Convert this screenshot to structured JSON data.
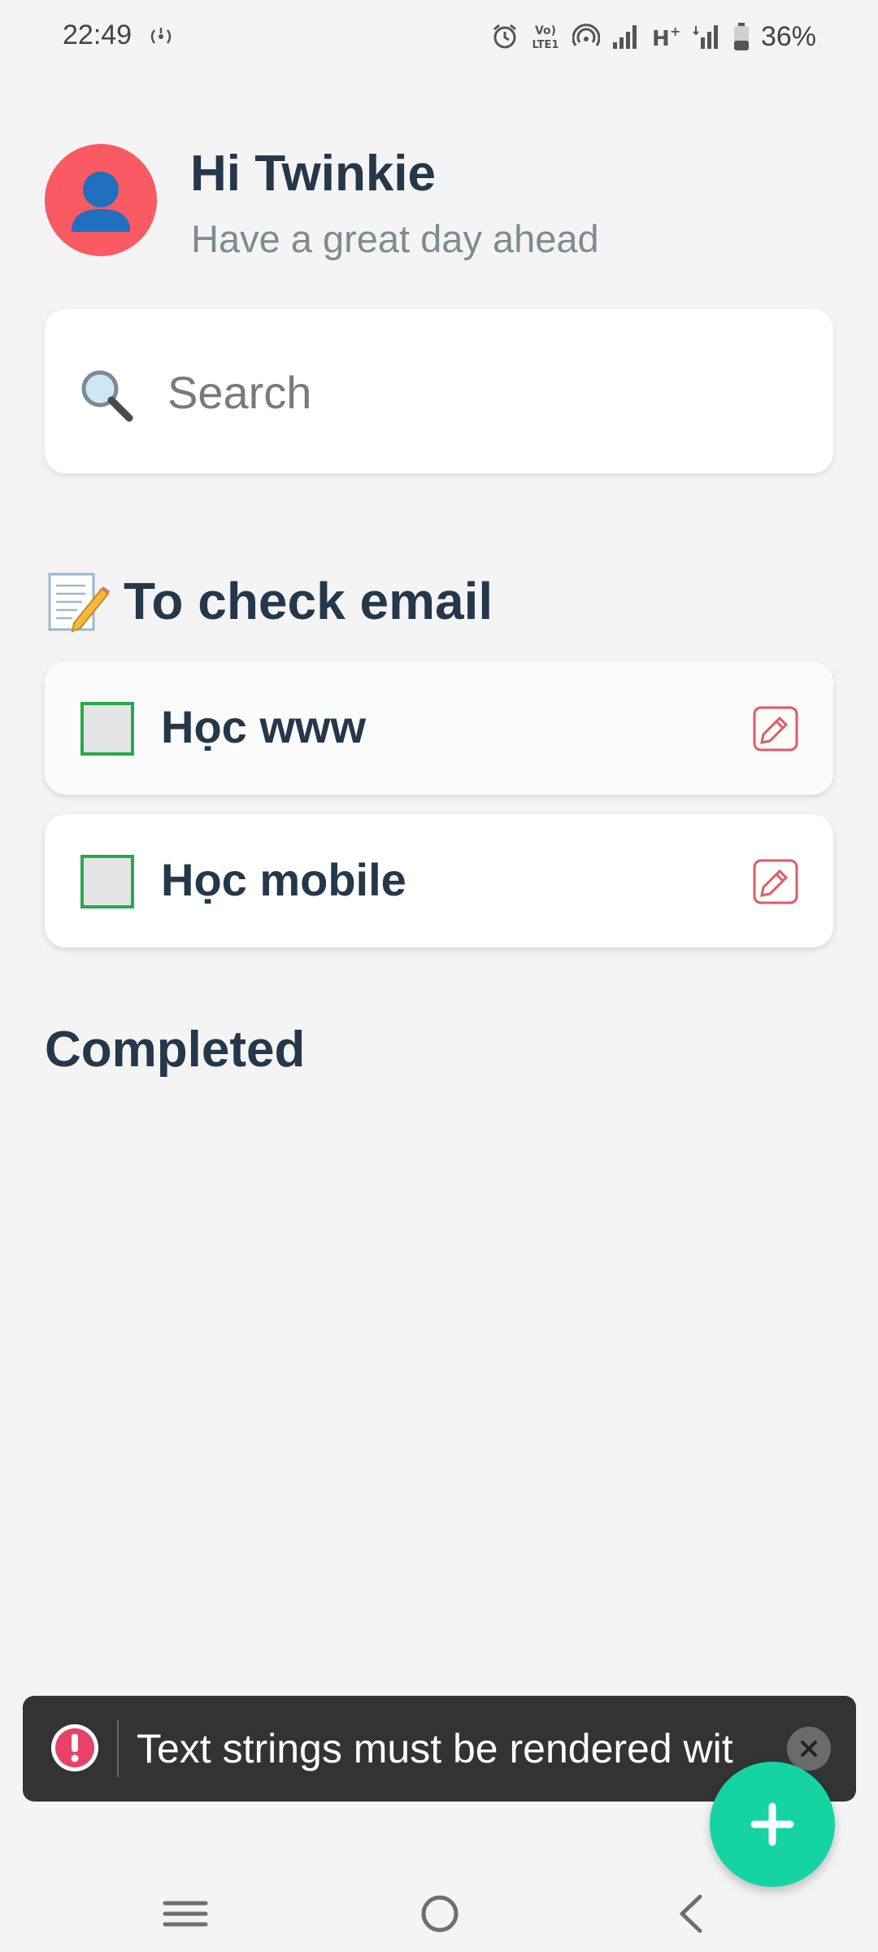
{
  "status_bar": {
    "time": "22:49",
    "battery": "36%",
    "icons": [
      "hotspot-icon",
      "alarm-icon",
      "volte-icon",
      "wifi-call-icon",
      "signal-icon",
      "hplus-icon",
      "signal-icon",
      "battery-icon"
    ],
    "network_label": "H+",
    "volte_label": "VoLTE1"
  },
  "header": {
    "avatar_icon": "user-icon",
    "greeting": "Hi Twinkie",
    "subtitle": "Have a great day ahead"
  },
  "search": {
    "icon": "search-icon",
    "placeholder": "Search"
  },
  "todo_section": {
    "icon": "memo-icon",
    "title": "To check email",
    "tasks": [
      {
        "label": "Học www",
        "checked": false,
        "edit_icon": "edit-icon"
      },
      {
        "label": "Học mobile",
        "checked": false,
        "edit_icon": "edit-icon"
      }
    ]
  },
  "completed_section": {
    "title": "Completed"
  },
  "toast": {
    "icon": "error-icon",
    "message": "Text strings must be rendered wit",
    "close_icon": "close-icon"
  },
  "fab": {
    "icon": "plus-icon"
  },
  "nav_bar": {
    "icons": [
      "recents-icon",
      "home-icon",
      "back-icon"
    ]
  },
  "colors": {
    "background": "#f4f4f4",
    "avatar": "#fa5a61",
    "checkbox_border": "#27a84a",
    "edit_icon": "#e05a66",
    "fab": "#16d3a4",
    "toast_bg": "#333333",
    "text_primary": "#25374a",
    "text_secondary": "#7f8c8d"
  }
}
